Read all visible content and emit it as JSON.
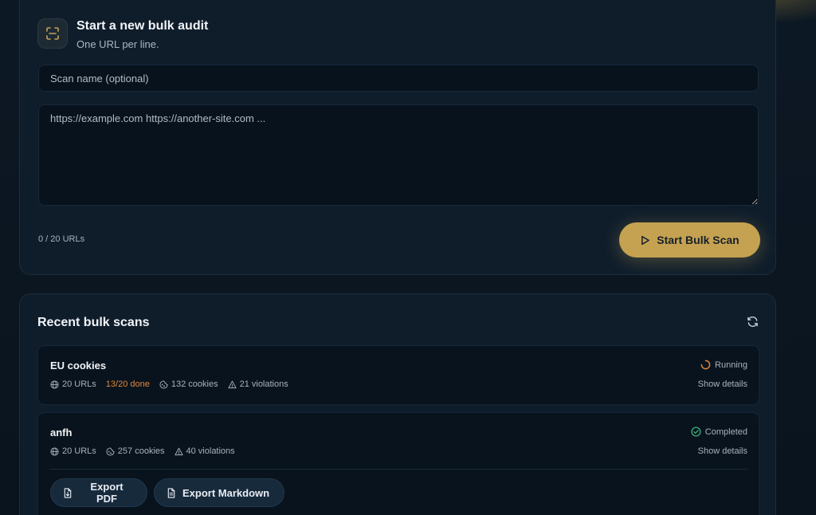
{
  "new_audit": {
    "title": "Start a new bulk audit",
    "subtitle": "One URL per line.",
    "scan_name_placeholder": "Scan name (optional)",
    "urls_placeholder": "https://example.com https://another-site.com ...",
    "url_count": "0 / 20 URLs",
    "start_label": "Start Bulk Scan",
    "icon": "scan-icon",
    "accent_color": "#c5a252"
  },
  "recent": {
    "title": "Recent bulk scans",
    "refresh_icon": "refresh-icon",
    "scans": [
      {
        "name": "EU cookies",
        "urls": "20 URLs",
        "progress": "13/20 done",
        "cookies": "132 cookies",
        "violations": "21 violations",
        "status": "Running",
        "status_color": "#e0883a",
        "details": "Show details"
      },
      {
        "name": "anfh",
        "urls": "20 URLs",
        "cookies": "257 cookies",
        "violations": "40 violations",
        "status": "Completed",
        "status_color": "#3fb37f",
        "details": "Show details",
        "export_pdf": "Export PDF",
        "export_md": "Export Markdown"
      }
    ]
  }
}
